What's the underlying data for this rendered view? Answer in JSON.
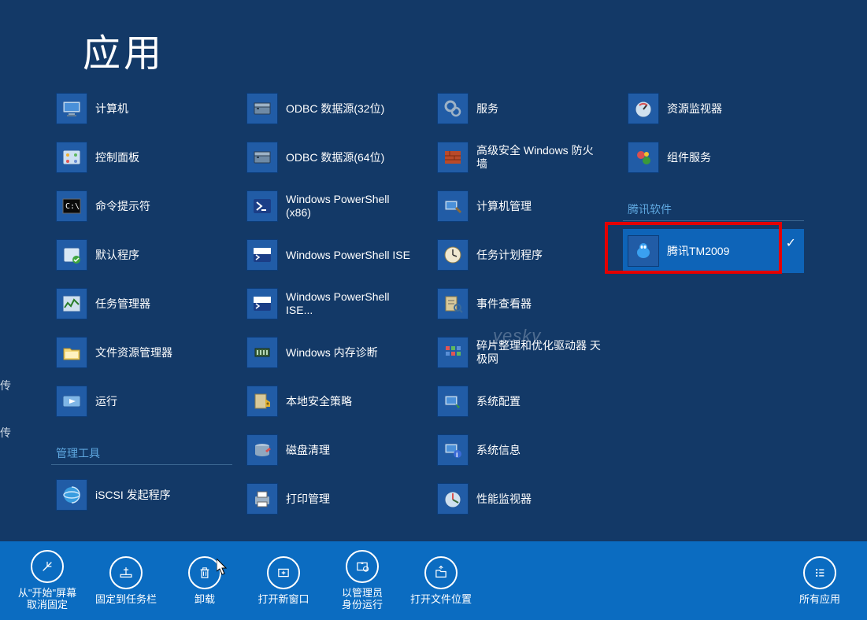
{
  "title": "应用",
  "edge_texts": [
    "传",
    "传"
  ],
  "watermark": "yesky",
  "columns": [
    {
      "items": [
        {
          "label": "计算机",
          "icon": "computer"
        },
        {
          "label": "控制面板",
          "icon": "control-panel"
        },
        {
          "label": "命令提示符",
          "icon": "cmd"
        },
        {
          "label": "默认程序",
          "icon": "defaults"
        },
        {
          "label": "任务管理器",
          "icon": "taskmgr"
        },
        {
          "label": "文件资源管理器",
          "icon": "explorer"
        },
        {
          "label": "运行",
          "icon": "run"
        }
      ],
      "group_header": "管理工具",
      "after_items": [
        {
          "label": "iSCSI 发起程序",
          "icon": "iscsi"
        }
      ]
    },
    {
      "items": [
        {
          "label": "ODBC 数据源(32位)",
          "icon": "odbc"
        },
        {
          "label": "ODBC 数据源(64位)",
          "icon": "odbc"
        },
        {
          "label": "Windows PowerShell (x86)",
          "icon": "powershell"
        },
        {
          "label": "Windows PowerShell ISE",
          "icon": "powershell-ise"
        },
        {
          "label": "Windows PowerShell ISE...",
          "icon": "powershell-ise"
        },
        {
          "label": "Windows 内存诊断",
          "icon": "memdiag"
        },
        {
          "label": "本地安全策略",
          "icon": "secpol"
        },
        {
          "label": "磁盘清理",
          "icon": "diskclean"
        },
        {
          "label": "打印管理",
          "icon": "print"
        }
      ]
    },
    {
      "items": [
        {
          "label": "服务",
          "icon": "services"
        },
        {
          "label": "高级安全 Windows 防火墙",
          "icon": "firewall"
        },
        {
          "label": "计算机管理",
          "icon": "compmgmt"
        },
        {
          "label": "任务计划程序",
          "icon": "taskschd"
        },
        {
          "label": "事件查看器",
          "icon": "eventvwr"
        },
        {
          "label": "碎片整理和优化驱动器 天极网",
          "icon": "defrag"
        },
        {
          "label": "系统配置",
          "icon": "msconfig"
        },
        {
          "label": "系统信息",
          "icon": "sysinfo"
        },
        {
          "label": "性能监视器",
          "icon": "perfmon"
        }
      ]
    },
    {
      "items": [
        {
          "label": "资源监视器",
          "icon": "resmon"
        },
        {
          "label": "组件服务",
          "icon": "comsvcs"
        }
      ],
      "group_header": "腾讯软件",
      "after_items": [
        {
          "label": "腾讯TM2009",
          "icon": "tm",
          "selected": true
        }
      ]
    }
  ],
  "appbar": [
    {
      "label": "从\"开始\"屏幕\n取消固定",
      "icon": "unpin"
    },
    {
      "label": "固定到任务栏",
      "icon": "pin-taskbar"
    },
    {
      "label": "卸载",
      "icon": "uninstall"
    },
    {
      "label": "打开新窗口",
      "icon": "new-window"
    },
    {
      "label": "以管理员\n身份运行",
      "icon": "run-admin"
    },
    {
      "label": "打开文件位置",
      "icon": "open-location"
    }
  ],
  "appbar_right": {
    "label": "所有应用",
    "icon": "all-apps"
  }
}
